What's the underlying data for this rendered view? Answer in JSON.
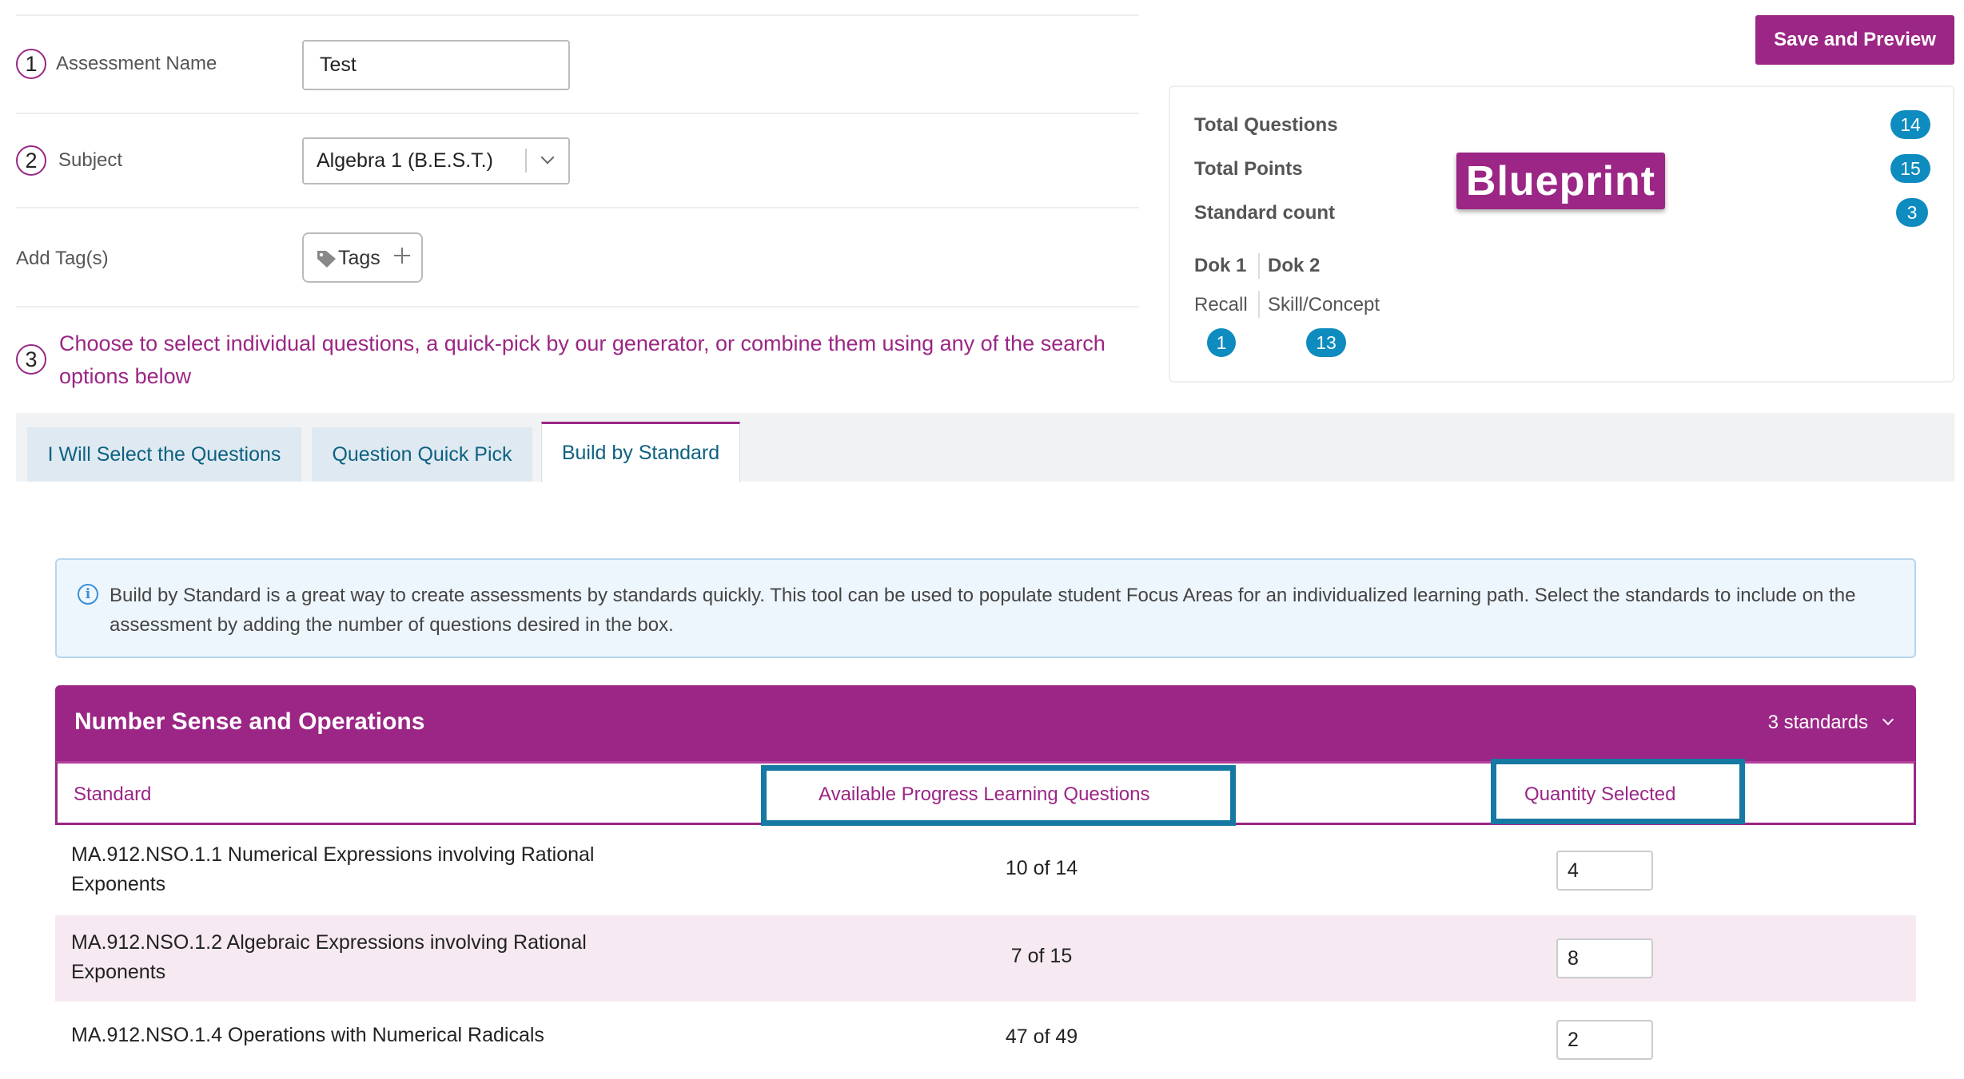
{
  "form": {
    "assessment_name": {
      "step": "1",
      "label": "Assessment Name",
      "value": "Test"
    },
    "subject": {
      "step": "2",
      "label": "Subject",
      "value": "Algebra 1 (B.E.S.T.)"
    },
    "tags": {
      "label": "Add Tag(s)",
      "button_label": "Tags"
    },
    "step3": {
      "step": "3",
      "text": "Choose to select individual questions, a quick-pick by our generator, or combine them using any of the search options below"
    }
  },
  "tabs": [
    {
      "label": "I Will Select the Questions"
    },
    {
      "label": "Question Quick Pick"
    },
    {
      "label": "Build by Standard",
      "active": true
    }
  ],
  "toolbar": {
    "save_label": "Save and Preview"
  },
  "blueprint": {
    "title": "Blueprint",
    "total_questions": {
      "label": "Total Questions",
      "value": "14"
    },
    "total_points": {
      "label": "Total Points",
      "value": "15"
    },
    "standard_count": {
      "label": "Standard count",
      "value": "3"
    },
    "dok": [
      {
        "label": "Dok 1",
        "sub": "Recall",
        "value": "1"
      },
      {
        "label": "Dok 2",
        "sub": "Skill/Concept",
        "value": "13"
      }
    ]
  },
  "info": {
    "text": "Build by Standard is a great way to create assessments by standards quickly. This tool can be used to populate student Focus Areas for an individualized learning path. Select the standards to include on the assessment by adding the number of questions desired in the box."
  },
  "section": {
    "title": "Number Sense and Operations",
    "count": "3 standards",
    "columns": {
      "standard": "Standard",
      "available": "Available Progress Learning Questions",
      "quantity": "Quantity Selected"
    },
    "rows": [
      {
        "standard": "MA.912.NSO.1.1 Numerical Expressions involving Rational Exponents",
        "available": "10 of 14",
        "quantity": "4"
      },
      {
        "standard": "MA.912.NSO.1.2 Algebraic Expressions involving Rational Exponents",
        "available": "7 of 15",
        "quantity": "8"
      },
      {
        "standard": "MA.912.NSO.1.4 Operations with Numerical Radicals",
        "available": "47 of 49",
        "quantity": "2"
      }
    ]
  },
  "colors": {
    "brand": "#9b2685",
    "badge": "#0e8bbf",
    "highlight": "#1579a3"
  },
  "icons": [
    "info-icon",
    "tag-icon",
    "plus-icon",
    "chevron-down-icon"
  ]
}
